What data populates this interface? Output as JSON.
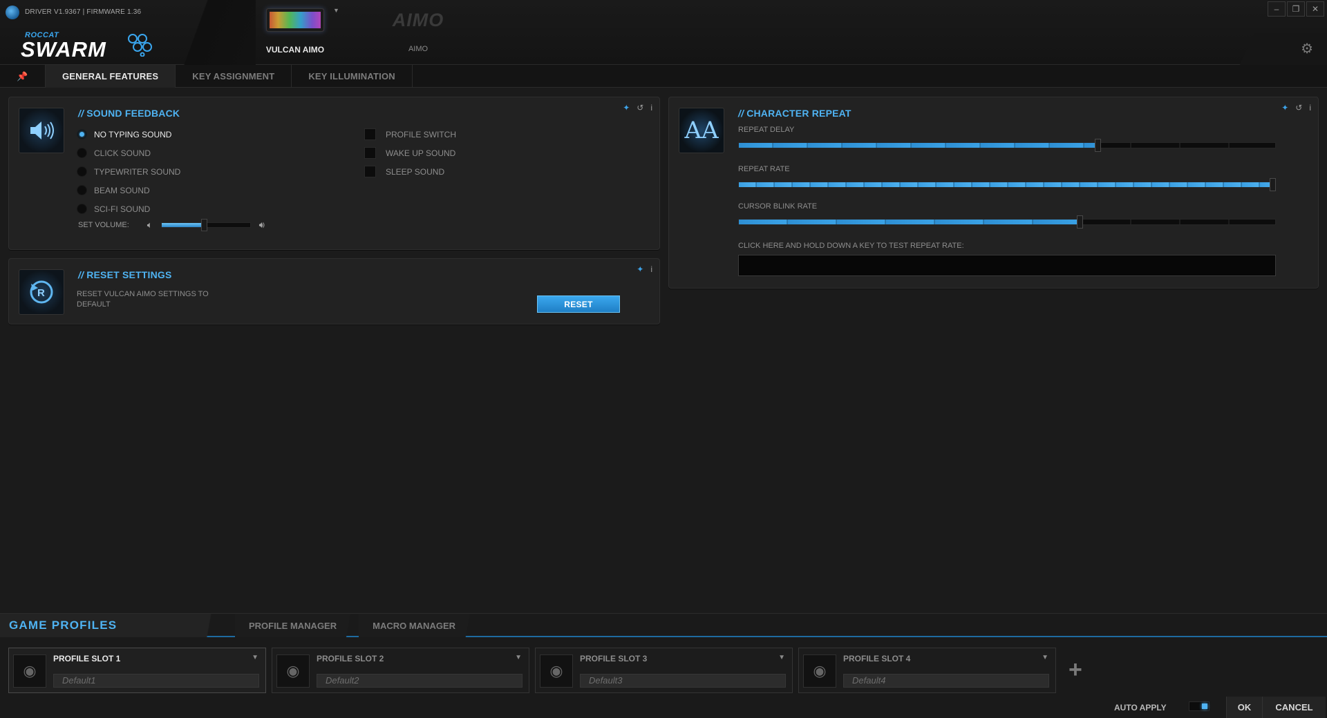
{
  "header": {
    "driver_text": "DRIVER V1.9367 | FIRMWARE 1.36",
    "logo_brand": "ROCCAT",
    "logo_product": "SWARM",
    "devices": [
      {
        "label": "VULCAN AIMO",
        "selected": true
      },
      {
        "label": "AIMO",
        "image_text": "AIMO",
        "selected": false
      }
    ],
    "window_controls": [
      "minimize-icon",
      "restore-icon",
      "close-icon"
    ]
  },
  "tabs": {
    "pin_icon": "pin-icon",
    "items": [
      {
        "label": "GENERAL FEATURES",
        "active": true
      },
      {
        "label": "KEY ASSIGNMENT",
        "active": false
      },
      {
        "label": "KEY ILLUMINATION",
        "active": false
      }
    ]
  },
  "sound_feedback": {
    "title": "SOUND FEEDBACK",
    "options": [
      {
        "label": "NO TYPING SOUND",
        "checked": true
      },
      {
        "label": "CLICK SOUND",
        "checked": false
      },
      {
        "label": "TYPEWRITER SOUND",
        "checked": false
      },
      {
        "label": "BEAM SOUND",
        "checked": false
      },
      {
        "label": "SCI-FI SOUND",
        "checked": false
      }
    ],
    "toggles": [
      {
        "label": "PROFILE SWITCH",
        "checked": false
      },
      {
        "label": "WAKE UP SOUND",
        "checked": false
      },
      {
        "label": "SLEEP SOUND",
        "checked": false
      }
    ],
    "volume_label": "SET VOLUME:",
    "volume_value": 0.48
  },
  "reset_settings": {
    "title": "RESET SETTINGS",
    "description": "RESET VULCAN AIMO SETTINGS TO DEFAULT",
    "button_label": "RESET"
  },
  "character_repeat": {
    "title": "CHARACTER REPEAT",
    "icon_text": "AA",
    "sliders": [
      {
        "label": "REPEAT DELAY",
        "value": 0.668
      },
      {
        "label": "REPEAT RATE",
        "value": 1.0
      },
      {
        "label": "CURSOR BLINK RATE",
        "value": 0.635
      }
    ],
    "test_label": "CLICK HERE AND HOLD DOWN A KEY TO TEST REPEAT RATE:",
    "test_value": ""
  },
  "profiles": {
    "title": "GAME PROFILES",
    "tabs": [
      "PROFILE MANAGER",
      "MACRO MANAGER"
    ],
    "slots": [
      {
        "name": "PROFILE SLOT 1",
        "value": "Default1",
        "active": true
      },
      {
        "name": "PROFILE SLOT 2",
        "value": "Default2",
        "active": false
      },
      {
        "name": "PROFILE SLOT 3",
        "value": "Default3",
        "active": false
      },
      {
        "name": "PROFILE SLOT 4",
        "value": "Default4",
        "active": false
      }
    ],
    "auto_apply_label": "AUTO APPLY",
    "auto_apply_on": true,
    "ok_label": "OK",
    "cancel_label": "CANCEL"
  },
  "colors": {
    "accent": "#4fb3f2",
    "background": "#1b1b1b",
    "panel": "#222222"
  }
}
